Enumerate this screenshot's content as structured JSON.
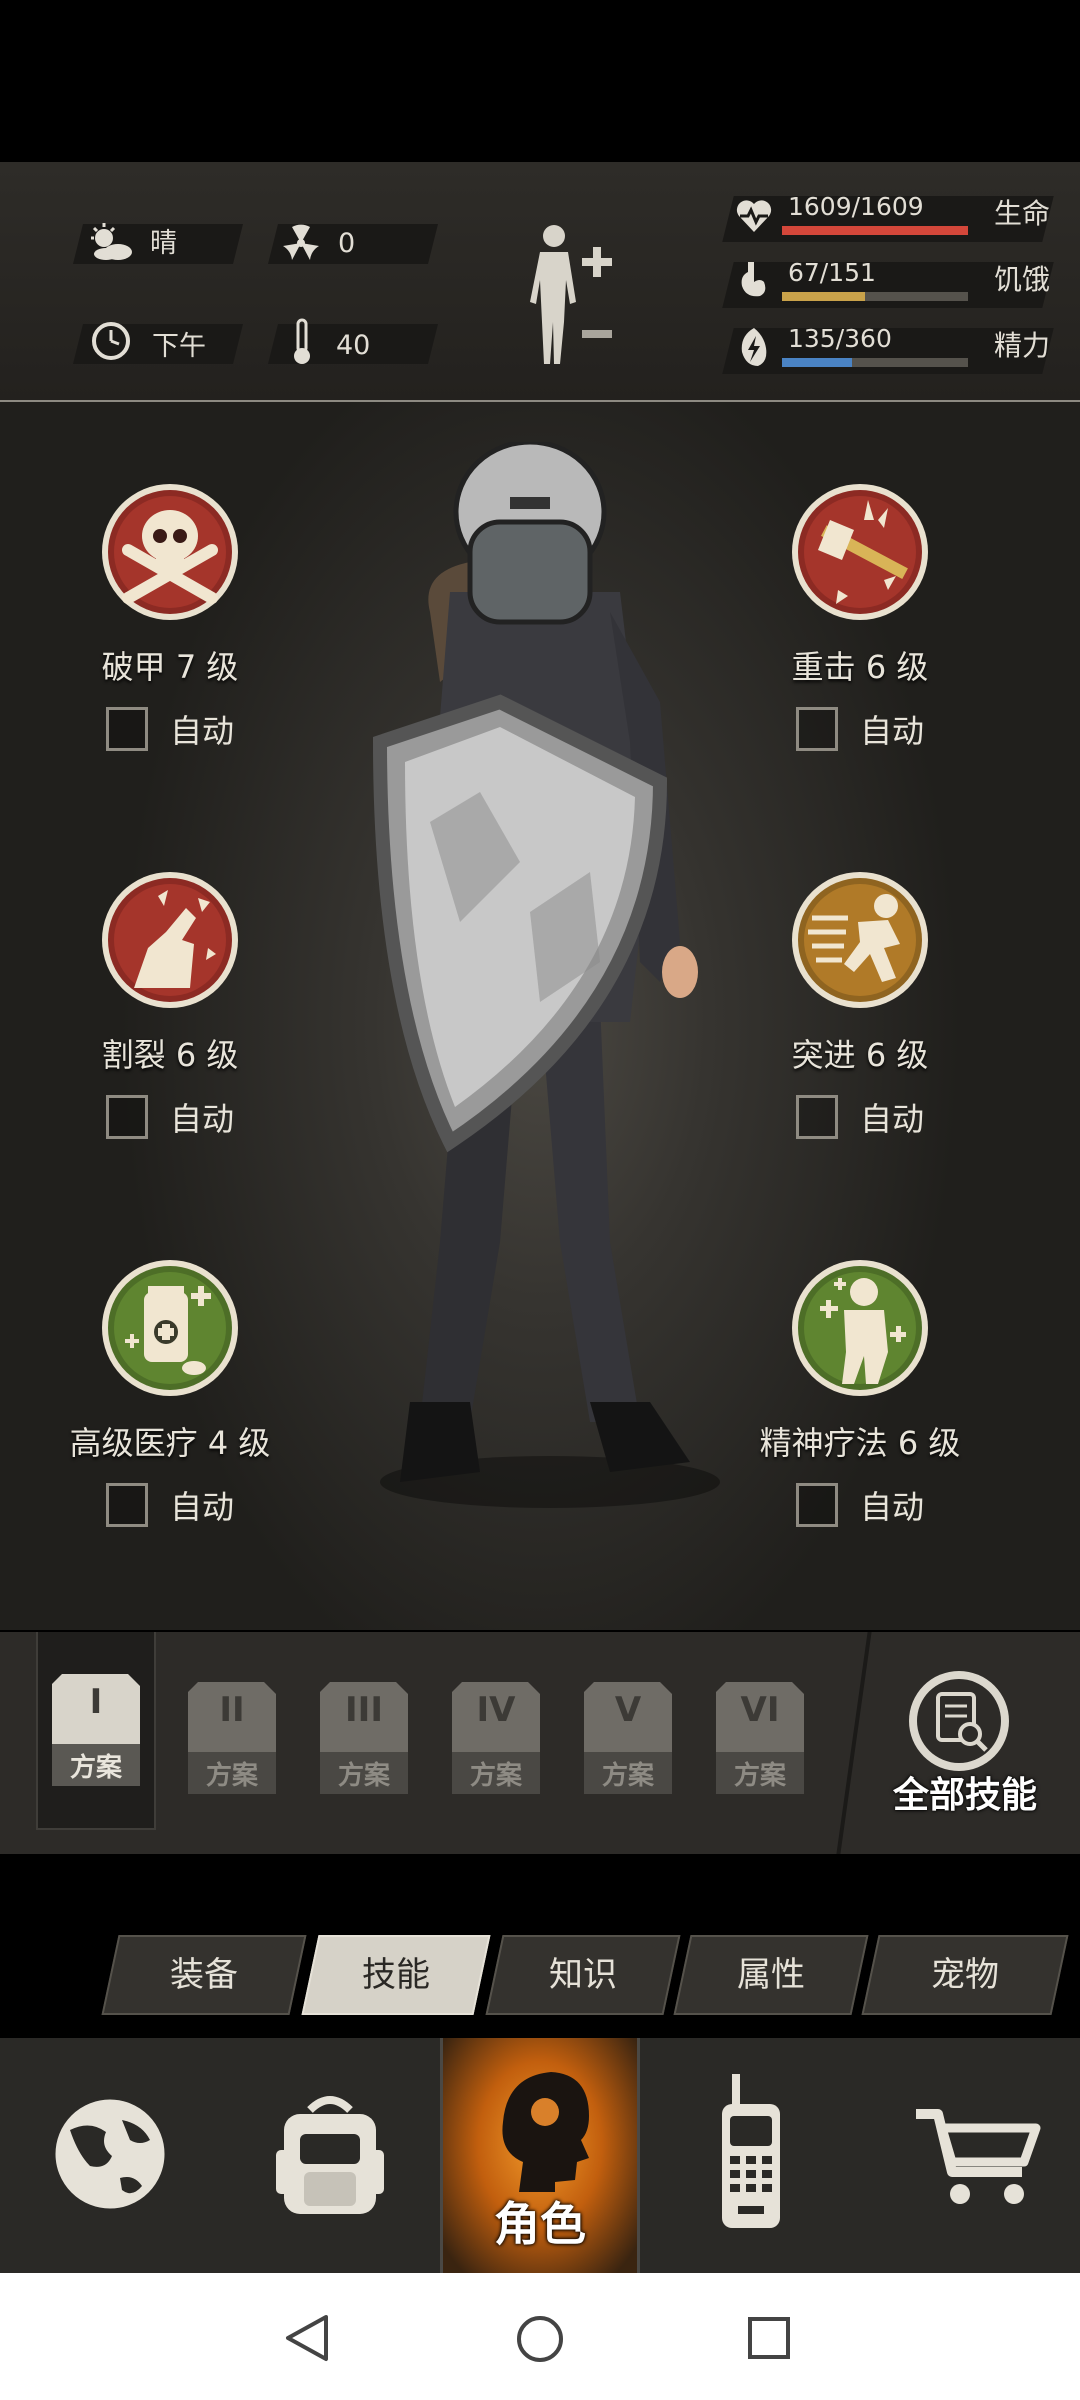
{
  "status": {
    "weather": "晴",
    "radiation": "0",
    "time_of_day": "下午",
    "temperature": "40",
    "health": {
      "value": "1609/1609",
      "label": "生命",
      "fraction": 1.0,
      "color": "#d4473a"
    },
    "hunger": {
      "value": "67/151",
      "label": "饥饿",
      "fraction": 0.444,
      "color": "#c9a24a"
    },
    "energy": {
      "value": "135/360",
      "label": "精力",
      "fraction": 0.375,
      "color": "#4a83c4"
    }
  },
  "skills": {
    "armor_break": {
      "name": "破甲 7 级",
      "auto": "自动"
    },
    "heavy_strike": {
      "name": "重击 6 级",
      "auto": "自动"
    },
    "lacerate": {
      "name": "割裂 6 级",
      "auto": "自动"
    },
    "charge": {
      "name": "突进 6 级",
      "auto": "自动"
    },
    "adv_medical": {
      "name": "高级医疗 4 级",
      "auto": "自动"
    },
    "mind_therapy": {
      "name": "精神疗法 6 级",
      "auto": "自动"
    }
  },
  "plans": [
    {
      "roman": "I",
      "label": "方案"
    },
    {
      "roman": "II",
      "label": "方案"
    },
    {
      "roman": "III",
      "label": "方案"
    },
    {
      "roman": "IV",
      "label": "方案"
    },
    {
      "roman": "V",
      "label": "方案"
    },
    {
      "roman": "VI",
      "label": "方案"
    }
  ],
  "all_skills_label": "全部技能",
  "tabs": [
    "装备",
    "技能",
    "知识",
    "属性",
    "宠物"
  ],
  "nav": {
    "character_label": "角色"
  },
  "icon_names": [
    "weather-sun-icon",
    "radiation-icon",
    "clock-icon",
    "thermometer-icon",
    "body-plus-minus-icon",
    "heart-icon",
    "stomach-icon",
    "energy-icon",
    "globe-icon",
    "backpack-icon",
    "walkie-talkie-icon",
    "cart-icon"
  ]
}
